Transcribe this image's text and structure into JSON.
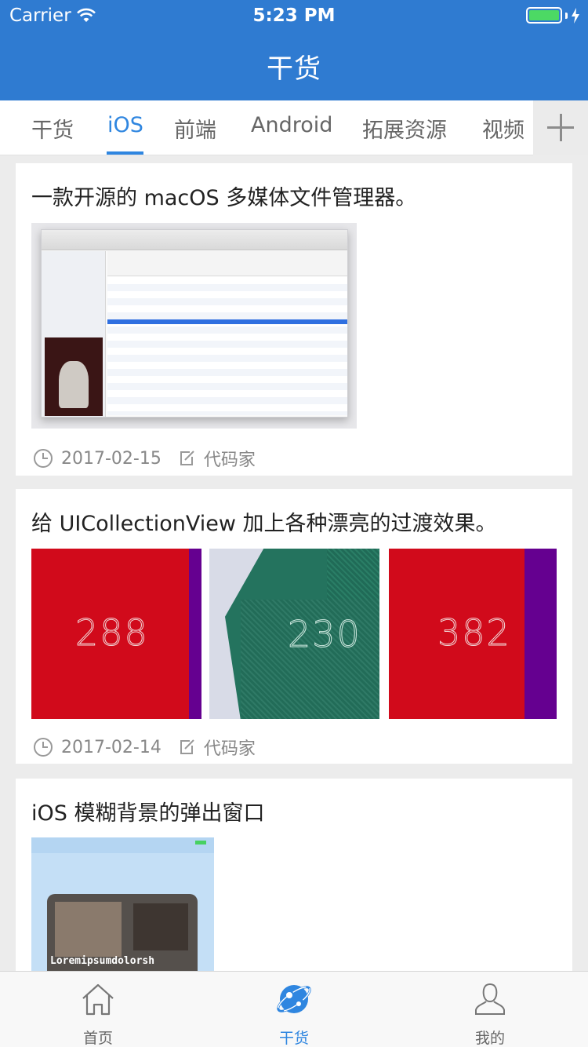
{
  "status_bar": {
    "carrier": "Carrier",
    "time": "5:23 PM"
  },
  "nav": {
    "title": "干货"
  },
  "tabs": [
    {
      "label": "干货",
      "active": false
    },
    {
      "label": "iOS",
      "active": true
    },
    {
      "label": "前端",
      "active": false
    },
    {
      "label": "Android",
      "active": false
    },
    {
      "label": "拓展资源",
      "active": false
    },
    {
      "label": "视频",
      "active": false
    }
  ],
  "articles": [
    {
      "title": "一款开源的 macOS 多媒体文件管理器。",
      "date": "2017-02-15",
      "author": "代码家"
    },
    {
      "title": "给 UICollectionView 加上各种漂亮的过渡效果。",
      "date": "2017-02-14",
      "author": "代码家",
      "thumbs": [
        "288",
        "230",
        "382"
      ]
    },
    {
      "title": "iOS 模糊背景的弹出窗口",
      "thumb_text": "Loremipsumdolorsh"
    }
  ],
  "tabbar": [
    {
      "label": "首页",
      "icon": "home-icon"
    },
    {
      "label": "干货",
      "icon": "planet-icon",
      "active": true
    },
    {
      "label": "我的",
      "icon": "user-icon"
    }
  ],
  "colors": {
    "accent": "#2f86e0",
    "nav": "#2f7bd1",
    "battery": "#4cd964"
  }
}
